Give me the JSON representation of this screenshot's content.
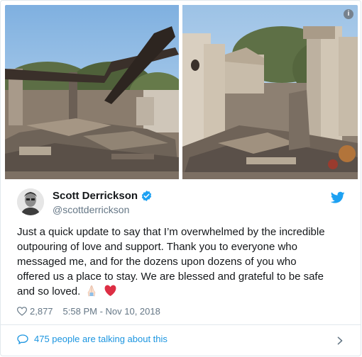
{
  "tweet": {
    "display_name": "Scott Derrickson",
    "handle": "@scottderrickson",
    "text": "Just a quick update to say that I’m overwhelmed by the incredible outpouring of love and support. Thank you to everyone who messaged me, and for the dozens upon dozens of you who offered us a place to stay. We are blessed and grateful to be safe and so loved.",
    "emoji": [
      "folded-hands-icon",
      "red-heart-icon"
    ],
    "likes": "2,877",
    "timestamp": "5:58 PM - Nov 10, 2018",
    "talking": "475 people are talking about this",
    "info_badge": "i"
  },
  "icons": {
    "verified": "verified-badge-icon",
    "brand": "twitter-bird-icon",
    "like": "heart-outline-icon",
    "conversation": "speech-bubble-icon",
    "more": "chevron-right-icon"
  },
  "colors": {
    "brand": "#1da1f2",
    "link": "#1b95e0",
    "muted": "#657786",
    "text": "#14171a",
    "heart": "#e0245e"
  }
}
